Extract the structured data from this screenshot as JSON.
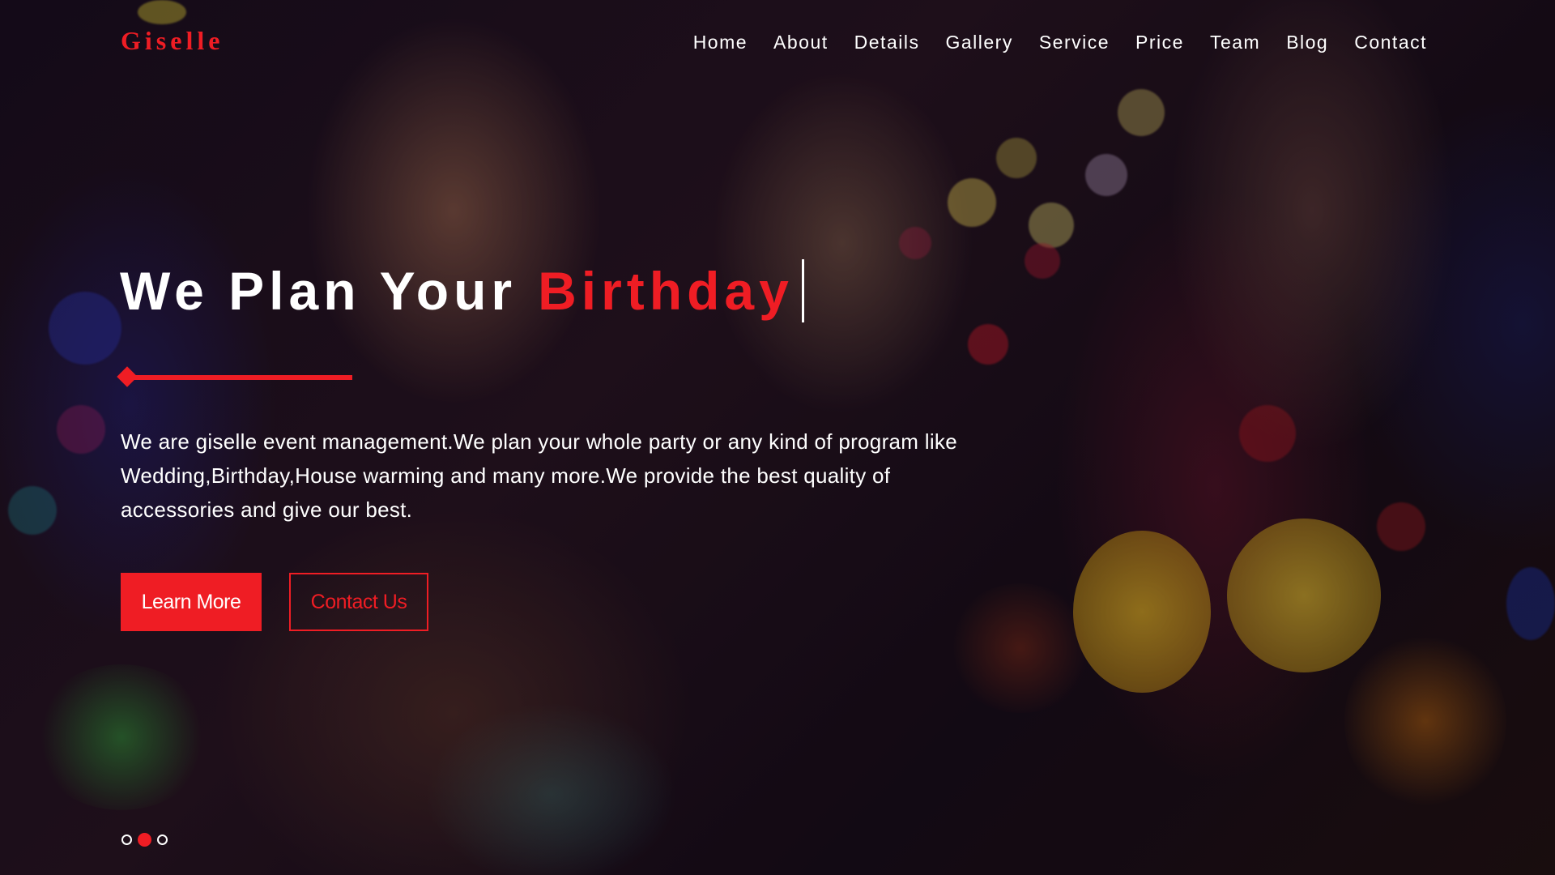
{
  "brand": {
    "name": "Giselle"
  },
  "nav": {
    "items": [
      {
        "label": "Home"
      },
      {
        "label": "About"
      },
      {
        "label": "Details"
      },
      {
        "label": "Gallery"
      },
      {
        "label": "Service"
      },
      {
        "label": "Price"
      },
      {
        "label": "Team"
      },
      {
        "label": "Blog"
      },
      {
        "label": "Contact"
      }
    ]
  },
  "hero": {
    "headline_prefix": "We Plan Your",
    "headline_accent": "Birthday",
    "description": "We are giselle event management.We plan your whole party or any kind of program like Wedding,Birthday,House warming and many more.We provide the best quality of accessories and give our best.",
    "primary_button": "Learn More",
    "secondary_button": "Contact Us",
    "background_image": "party-people-with-cocktails-photo"
  },
  "slider": {
    "total_slides": 3,
    "active_index": 1
  },
  "colors": {
    "accent": "#ef1d24",
    "text": "#ffffff"
  }
}
